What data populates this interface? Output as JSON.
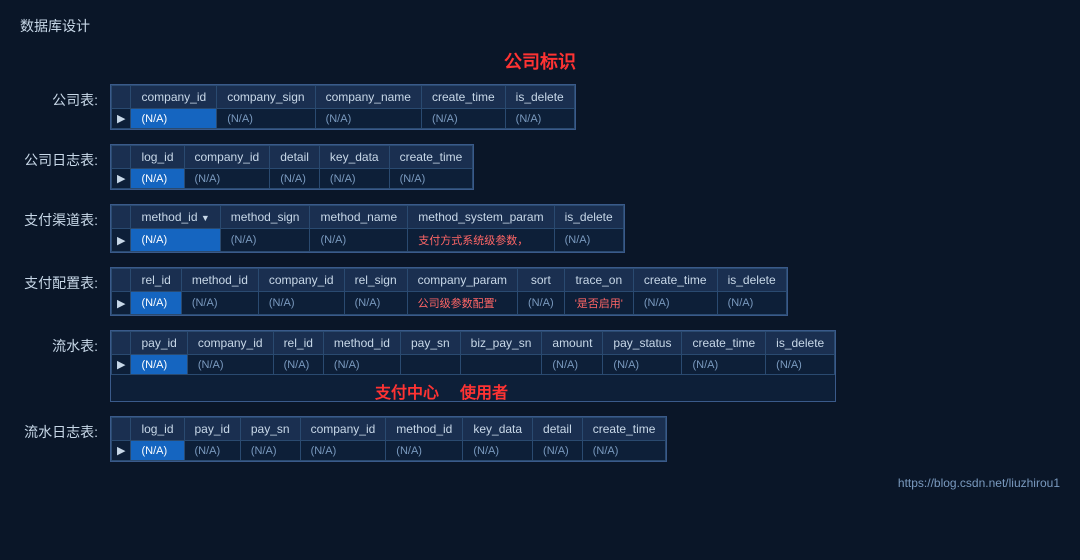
{
  "pageTitle": "数据库设计",
  "centerLabel": "公司标识",
  "footerLink": "https://blog.csdn.net/liuzhirou1",
  "sections": [
    {
      "label": "公司表:",
      "columns": [
        "company_id",
        "company_sign",
        "company_name",
        "create_time",
        "is_delete"
      ],
      "row": [
        "(N/A)",
        "(N/A)",
        "(N/A)",
        "(N/A)",
        "(N/A)"
      ],
      "highlightCol": 0
    },
    {
      "label": "公司日志表:",
      "columns": [
        "log_id",
        "company_id",
        "detail",
        "key_data",
        "create_time"
      ],
      "row": [
        "(N/A)",
        "(N/A)",
        "(N/A)",
        "(N/A)",
        "(N/A)"
      ],
      "highlightCol": 0
    },
    {
      "label": "支付渠道表:",
      "columns": [
        "method_id ▼",
        "method_sign",
        "method_name",
        "method_system_param",
        "is_delete"
      ],
      "row": [
        "(N/A)",
        "(N/A)",
        "(N/A)",
        "支付方式系统级参数，",
        "(N/A)"
      ],
      "highlightCol": 0,
      "redCols": [
        3
      ]
    },
    {
      "label": "支付配置表:",
      "columns": [
        "rel_id",
        "method_id",
        "company_id",
        "rel_sign",
        "company_param",
        "sort",
        "trace_on",
        "create_time",
        "is_delete"
      ],
      "row": [
        "(N/A)",
        "(N/A)",
        "(N/A)",
        "(N/A)",
        "公司级参数配置'",
        "(N/A)",
        "'是否启用'",
        "(N/A)",
        "(N/A)"
      ],
      "highlightCol": 0,
      "redCols": [
        4,
        6
      ]
    },
    {
      "label": "流水表:",
      "columns": [
        "pay_id",
        "company_id",
        "rel_id",
        "method_id",
        "pay_sn",
        "biz_pay_sn",
        "amount",
        "pay_status",
        "create_time",
        "is_delete"
      ],
      "row": [
        "(N/A)",
        "(N/A)",
        "(N/A)",
        "(N/A)",
        "",
        "",
        "(N/A)",
        "(N/A)",
        "(N/A)",
        "(N/A)"
      ],
      "highlightCol": 0,
      "annotations": [
        {
          "col": 4,
          "text": "支付中心",
          "colspan": 1
        },
        {
          "col": 5,
          "text": "使用者",
          "colspan": 1
        }
      ]
    },
    {
      "label": "流水日志表:",
      "columns": [
        "log_id",
        "pay_id",
        "pay_sn",
        "company_id",
        "method_id",
        "key_data",
        "detail",
        "create_time"
      ],
      "row": [
        "(N/A)",
        "(N/A)",
        "(N/A)",
        "(N/A)",
        "(N/A)",
        "(N/A)",
        "(N/A)",
        "(N/A)"
      ],
      "highlightCol": 0
    }
  ]
}
